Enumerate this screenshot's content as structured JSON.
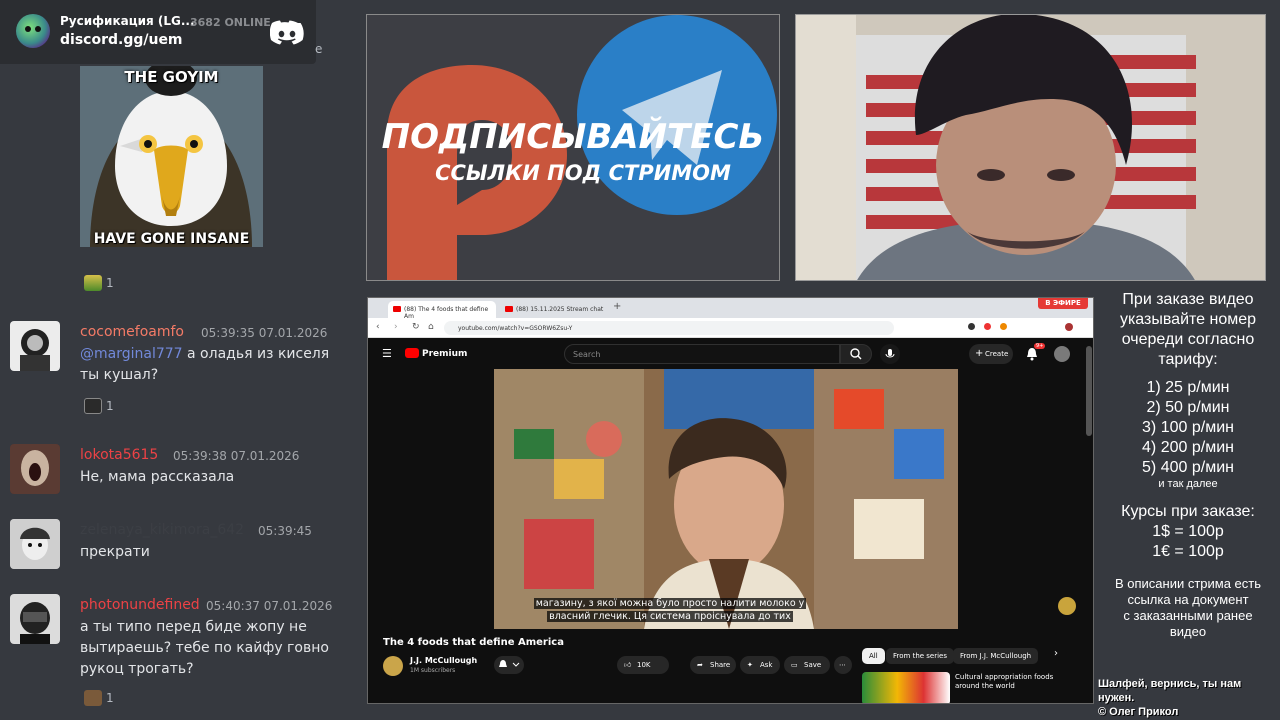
{
  "discord": {
    "server_name": "Русификация (LG...",
    "online_count": "3682 ONLINE",
    "invite": "discord.gg/uem",
    "widget_edge_char": "e"
  },
  "chat": {
    "meme": {
      "top_text": "THE GOYIM",
      "bottom_text": "HAVE GONE INSANE",
      "reaction_count": "1"
    },
    "messages": [
      {
        "username": "cocomefoamfo",
        "color": "#f47b67",
        "time": "05:39:35 07.01.2026",
        "mention": "@marginal777",
        "text": " а оладья из киселя ты кушал?",
        "reaction_count": "1"
      },
      {
        "username": "lokota5615",
        "color": "#ed4245",
        "time": "05:39:38 07.01.2026",
        "text": "Не, мама рассказала"
      },
      {
        "username": "zelenaya_kikimora_642",
        "color": "#3c3f45",
        "time": "05:39:45",
        "text": "прекрати"
      },
      {
        "username": "photonundefined",
        "color": "#ed4245",
        "time": "05:40:37 07.01.2026",
        "text": "а ты типо перед биде жопу не вытираешь? тебе по кайфу говно рукоц трогать?",
        "reaction_count": "1"
      }
    ]
  },
  "banner": {
    "title": "ПОДПИСЫВАЙТЕСЬ",
    "subtitle": "ССЫЛКИ ПОД СТРИМОМ"
  },
  "browser": {
    "tabs": [
      {
        "label": "(88) The 4 foods that define Am"
      },
      {
        "label": "(88) 15.11.2025 Stream chat"
      }
    ],
    "url": "youtube.com/watch?v=GSORW6Zsu-Y",
    "live_badge": "В ЭФИРЕ",
    "youtube": {
      "brand": "Premium",
      "search_placeholder": "Search",
      "create_label": "Create",
      "notif_count": "9+",
      "subtitle_line1": "магазину, з якої можна було просто налити молоко у",
      "subtitle_line2": "власний глечик. Ця система проіснувала до тих",
      "video_title": "The 4 foods that define America",
      "channel_name": "J.J. McCullough",
      "channel_subs": "1M subscribers",
      "likes": "10K",
      "share_label": "Share",
      "ask_label": "Ask",
      "save_label": "Save",
      "chips": [
        "All",
        "From the series",
        "From J.J. McCullough"
      ],
      "rec_title": "Cultural appropriation foods around the world"
    }
  },
  "prices": {
    "intro": [
      "При заказе видео",
      "указывайте номер",
      "очереди согласно",
      "тарифу:"
    ],
    "tiers": [
      "1) 25 р/мин",
      "2) 50 р/мин",
      "3) 100 р/мин",
      "4) 200 р/мин",
      "5) 400 р/мин"
    ],
    "etc": "и так далее",
    "rates_title": "Курсы при заказе:",
    "rates": [
      "1$ = 100р",
      "1€ = 100р"
    ],
    "note": [
      "В описании стрима есть",
      "ссылка на документ",
      "с заказанными ранее",
      "видео"
    ]
  },
  "credits": {
    "line1": "Шалфей, вернись, ты нам нужен.",
    "line2": "© Олег Прикол"
  }
}
